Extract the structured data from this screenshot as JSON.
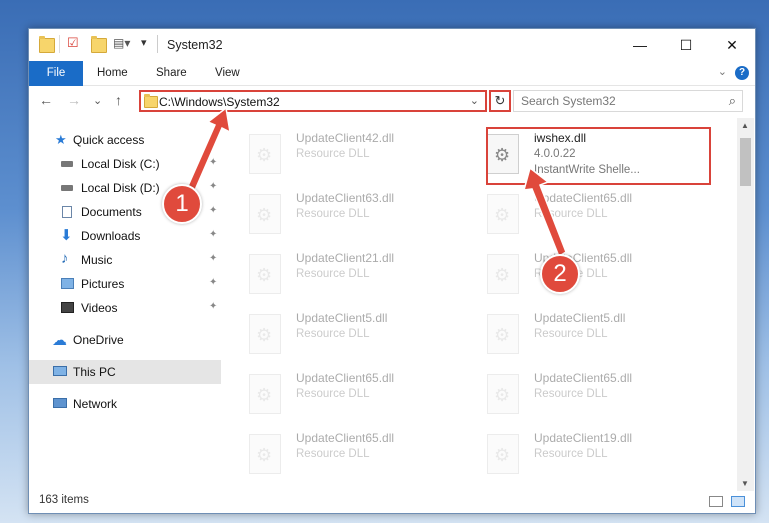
{
  "window": {
    "title": "System32",
    "minimize_glyph": "—",
    "maximize_glyph": "☐",
    "close_glyph": "✕"
  },
  "ribbon": {
    "tabs": [
      {
        "label": "File"
      },
      {
        "label": "Home"
      },
      {
        "label": "Share"
      },
      {
        "label": "View"
      }
    ],
    "help_glyph": "?",
    "collapse_glyph": "⌄"
  },
  "navigation": {
    "back_glyph": "←",
    "forward_glyph": "→",
    "recent_glyph": "⌄",
    "up_glyph": "↑",
    "address": "C:\\Windows\\System32",
    "address_dropdown_glyph": "⌄",
    "refresh_glyph": "↻",
    "search_placeholder": "Search System32",
    "search_glyph": "⌕"
  },
  "sidebar": {
    "items": [
      {
        "label": "Quick access",
        "icon": "star-icon",
        "pinned": false
      },
      {
        "label": "Local Disk (C:)",
        "icon": "drive-icon",
        "pinned": true
      },
      {
        "label": "Local Disk (D:)",
        "icon": "drive-icon",
        "pinned": true
      },
      {
        "label": "Documents",
        "icon": "document-icon",
        "pinned": true
      },
      {
        "label": "Downloads",
        "icon": "download-icon",
        "pinned": true
      },
      {
        "label": "Music",
        "icon": "music-icon",
        "pinned": true
      },
      {
        "label": "Pictures",
        "icon": "picture-icon",
        "pinned": true
      },
      {
        "label": "Videos",
        "icon": "video-icon",
        "pinned": true
      },
      {
        "label": "OneDrive",
        "icon": "cloud-icon",
        "pinned": false
      },
      {
        "label": "This PC",
        "icon": "computer-icon",
        "pinned": false,
        "selected": true
      },
      {
        "label": "Network",
        "icon": "network-icon",
        "pinned": false
      }
    ],
    "pin_glyph": "📌"
  },
  "files": {
    "left_column": [
      {
        "name": "UpdateClient42.dll",
        "type": "Resource DLL"
      },
      {
        "name": "UpdateClient63.dll",
        "type": "Resource DLL"
      },
      {
        "name": "UpdateClient21.dll",
        "type": "Resource DLL"
      },
      {
        "name": "UpdateClient5.dll",
        "type": "Resource DLL"
      },
      {
        "name": "UpdateClient65.dll",
        "type": "Resource DLL"
      },
      {
        "name": "UpdateClient65.dll",
        "type": "Resource DLL"
      }
    ],
    "highlighted": {
      "name": "iwshex.dll",
      "version": "4.0.0.22",
      "description": "InstantWrite Shelle..."
    },
    "right_column": [
      {
        "name": "UpdateClient65.dll",
        "type": "Resource DLL"
      },
      {
        "name": "UpdateClient65.dll",
        "type": "Resource DLL"
      },
      {
        "name": "UpdateClient5.dll",
        "type": "Resource DLL"
      },
      {
        "name": "UpdateClient65.dll",
        "type": "Resource DLL"
      },
      {
        "name": "UpdateClient19.dll",
        "type": "Resource DLL"
      }
    ]
  },
  "status": {
    "item_count": "163 items"
  },
  "annotations": {
    "badge_1": "1",
    "badge_2": "2",
    "accent_color": "#e04a3c"
  }
}
